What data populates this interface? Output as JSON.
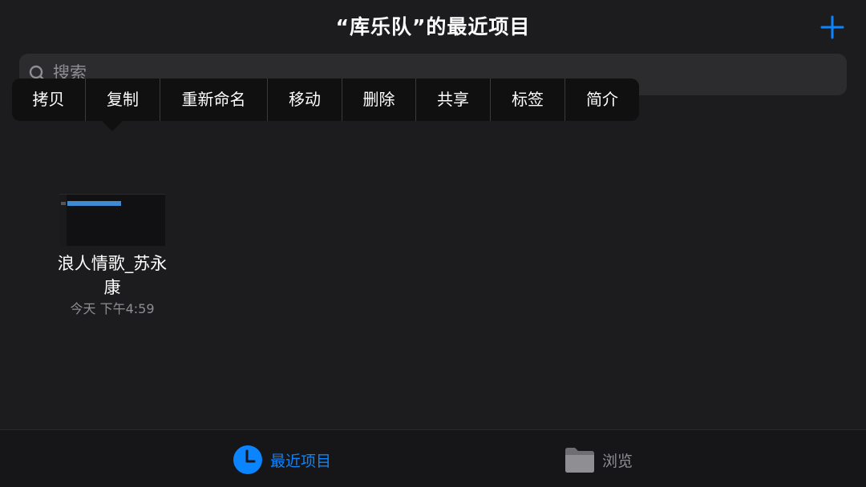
{
  "header": {
    "title": "“库乐队”的最近项目"
  },
  "search": {
    "placeholder": "搜索"
  },
  "context_menu": {
    "items": [
      {
        "label": "拷贝"
      },
      {
        "label": "复制"
      },
      {
        "label": "重新命名"
      },
      {
        "label": "移动"
      },
      {
        "label": "删除"
      },
      {
        "label": "共享"
      },
      {
        "label": "标签"
      },
      {
        "label": "简介"
      }
    ]
  },
  "files": [
    {
      "name_line1": "浪人情歌_苏永",
      "name_line2": "康",
      "date": "今天 下午4:59"
    }
  ],
  "tab_bar": {
    "tabs": [
      {
        "label": "最近项目",
        "icon": "clock-icon",
        "selected": true
      },
      {
        "label": "浏览",
        "icon": "folder-icon",
        "selected": false
      }
    ]
  },
  "colors": {
    "accent": "#0a84ff",
    "background": "#1c1c1e",
    "secondary_text": "#8e8e93",
    "menu_background": "#101010"
  }
}
